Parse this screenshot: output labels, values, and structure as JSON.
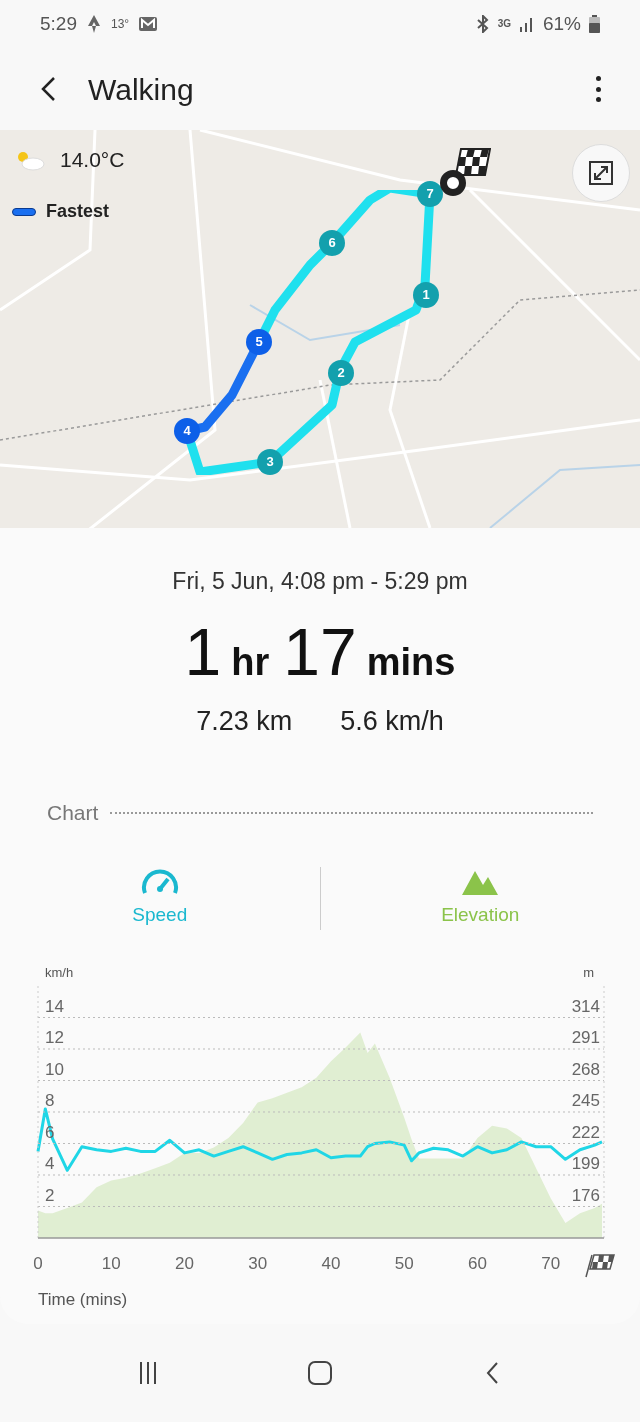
{
  "status_bar": {
    "time": "5:29",
    "temperature": "13°",
    "network": "3G",
    "battery": "61%"
  },
  "header": {
    "title": "Walking"
  },
  "map": {
    "weather": "14.0°C",
    "legend": "Fastest",
    "markers": [
      {
        "label": "1",
        "kind": "normal"
      },
      {
        "label": "2",
        "kind": "normal"
      },
      {
        "label": "3",
        "kind": "normal"
      },
      {
        "label": "4",
        "kind": "fastest"
      },
      {
        "label": "5",
        "kind": "fastest"
      },
      {
        "label": "6",
        "kind": "normal"
      },
      {
        "label": "7",
        "kind": "normal"
      }
    ]
  },
  "summary": {
    "date_range": "Fri, 5 Jun, 4:08 pm - 5:29 pm",
    "duration": [
      {
        "value": "1",
        "unit": "hr"
      },
      {
        "value": "17",
        "unit": "mins"
      }
    ],
    "distance": "7.23 km",
    "avg_speed": "5.6 km/h"
  },
  "chart_section": {
    "title": "Chart",
    "charts": [
      {
        "toggle": {
          "on": true,
          "color": "#1ab8cf"
        },
        "chart_data": {
          "type": "line",
          "xlabel": "Time (mins)",
          "ylabel": "km/h",
          "grid": true,
          "xlim": [
            0,
            77
          ],
          "ylim": [
            0,
            16
          ],
          "xticks": [
            0,
            10,
            20,
            30,
            40,
            50,
            60,
            70
          ],
          "yticks": [
            2,
            4,
            6,
            8,
            10,
            12,
            14
          ],
          "x": [
            0,
            1,
            2,
            4,
            6,
            8,
            10,
            12,
            14,
            16,
            18,
            20,
            22,
            24,
            26,
            28,
            30,
            32,
            34,
            36,
            38,
            40,
            42,
            44,
            45,
            46,
            48,
            50,
            51,
            52,
            54,
            56,
            58,
            60,
            62,
            64,
            66,
            68,
            70,
            72,
            74,
            76,
            77
          ],
          "series": [
            {
              "name": "Speed",
              "color": "#1fd6e6",
              "values": [
                5.5,
                8.2,
                6.3,
                4.3,
                5.8,
                5.6,
                5.5,
                5.7,
                5.5,
                5.5,
                6.2,
                5.4,
                5.6,
                5.2,
                5.5,
                5.8,
                5.4,
                5.0,
                5.3,
                5.4,
                5.6,
                5.1,
                5.2,
                5.2,
                5.8,
                6.0,
                6.1,
                5.9,
                4.9,
                5.4,
                5.7,
                5.6,
                5.2,
                5.8,
                5.4,
                5.6,
                6.1,
                5.8,
                5.8,
                5.0,
                5.6,
                5.9,
                6.1
              ]
            }
          ]
        }
      },
      {
        "toggle": {
          "on": true,
          "color": "#8bc34a"
        },
        "chart_data": {
          "type": "area",
          "ylabel": "m",
          "xlim": [
            0,
            77
          ],
          "ylim": [
            153,
            337
          ],
          "yticks": [
            176,
            199,
            222,
            245,
            268,
            291,
            314
          ],
          "x": [
            0,
            1,
            2,
            4,
            6,
            8,
            10,
            12,
            14,
            16,
            18,
            20,
            22,
            24,
            26,
            28,
            30,
            32,
            34,
            36,
            38,
            40,
            42,
            44,
            45,
            46,
            48,
            50,
            51,
            52,
            54,
            56,
            58,
            60,
            62,
            64,
            66,
            68,
            70,
            72,
            74,
            76,
            77
          ],
          "series": [
            {
              "name": "Elevation",
              "color": "#e0eed2",
              "values": [
                173,
                171,
                171,
                175,
                179,
                190,
                195,
                197,
                200,
                204,
                208,
                215,
                215,
                219,
                226,
                237,
                252,
                255,
                259,
                263,
                270,
                282,
                292,
                303,
                288,
                295,
                270,
                241,
                225,
                211,
                211,
                211,
                211,
                226,
                235,
                233,
                226,
                204,
                182,
                164,
                171,
                175,
                178
              ]
            }
          ]
        }
      }
    ]
  }
}
